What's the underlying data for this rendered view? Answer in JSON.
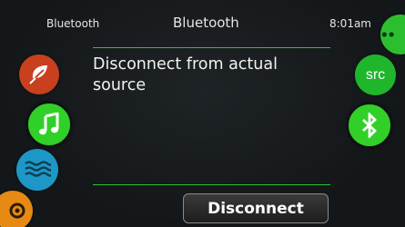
{
  "header": {
    "source_label": "Bluetooth",
    "title": "Bluetooth",
    "time": "8:01am"
  },
  "main": {
    "message": "Disconnect from actual source",
    "action_button": "Disconnect"
  },
  "left_menu": {
    "items": [
      {
        "icon": "leaf-icon",
        "color": "#c8401e"
      },
      {
        "icon": "music-note-icon",
        "color": "#31d028"
      },
      {
        "icon": "waves-icon",
        "color": "#1d98c6"
      },
      {
        "icon": "gear-icon",
        "color": "#e68a14"
      }
    ]
  },
  "right_menu": {
    "src_label": "src",
    "items": [
      {
        "icon": "dots-icon",
        "color": "#2bbf30"
      },
      {
        "icon": "source-icon",
        "color": "#1fb62c"
      },
      {
        "icon": "bluetooth-icon",
        "color": "#31d028"
      }
    ]
  },
  "colors": {
    "accent_green": "#2fbf3a",
    "background": "#161a1c"
  }
}
